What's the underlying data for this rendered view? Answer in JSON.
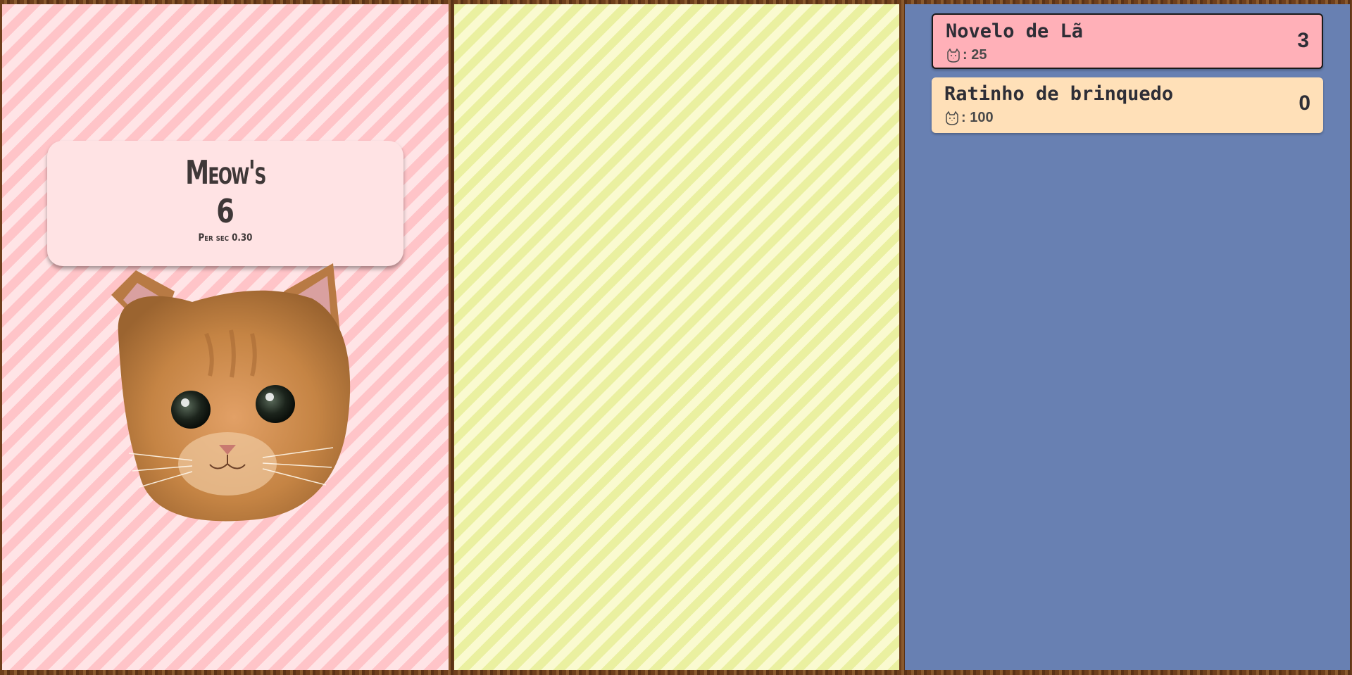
{
  "score": {
    "title": "Meow's",
    "count": "6",
    "rate_label": "Per sec 0.30"
  },
  "cat": {
    "icon": "cat-face-image"
  },
  "shop": {
    "items": [
      {
        "name": "Novelo de Lã",
        "price": ": 25",
        "owned": "3",
        "selected": true
      },
      {
        "name": "Ratinho de brinquedo",
        "price": ": 100",
        "owned": "0",
        "selected": false
      }
    ]
  },
  "colors": {
    "left_stripe": "#ffc4c8",
    "middle_stripe": "#eaf0a0",
    "right_panel": "#6880b2",
    "selected_item": "#ffb0b8",
    "item": "#ffe0b8"
  }
}
